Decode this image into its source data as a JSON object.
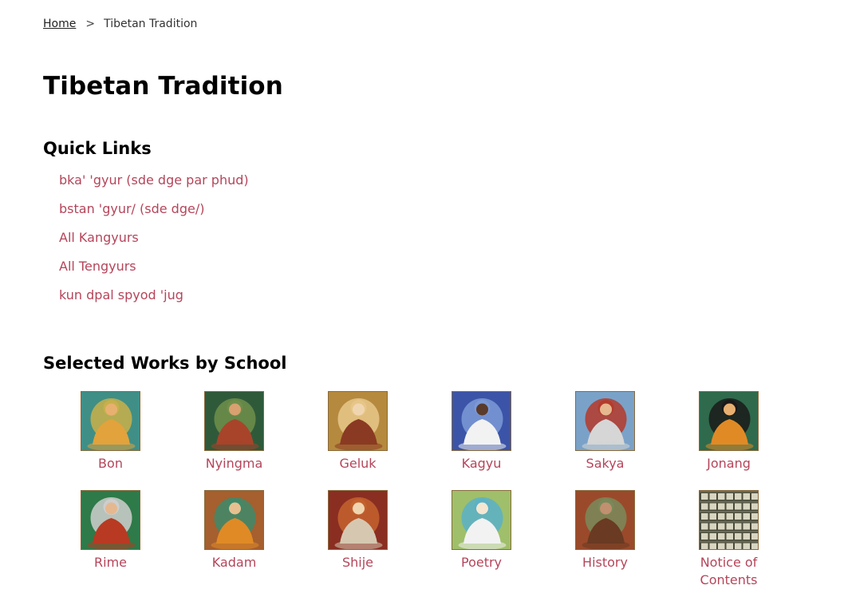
{
  "breadcrumb": {
    "home": "Home",
    "separator": ">",
    "current": "Tibetan Tradition"
  },
  "page_title": "Tibetan Tradition",
  "quick_links": {
    "heading": "Quick Links",
    "items": [
      "bka' 'gyur (sde dge par phud)",
      "bstan 'gyur/ (sde dge/)",
      "All Kangyurs",
      "All Tengyurs",
      "kun dpal spyod 'jug"
    ]
  },
  "selected_works": {
    "heading": "Selected Works by School",
    "schools": [
      {
        "label": "Bon",
        "icon": "thangka-bon-icon",
        "bg": "#3f8f86",
        "robe": "#e2a23c",
        "halo": "#c9b04a",
        "skin": "#e8b070"
      },
      {
        "label": "Nyingma",
        "icon": "thangka-nyingma-icon",
        "bg": "#2f5a3a",
        "robe": "#a8442a",
        "halo": "#6e8f4a",
        "skin": "#d9a070"
      },
      {
        "label": "Geluk",
        "icon": "thangka-geluk-icon",
        "bg": "#b58a3e",
        "robe": "#8a3a22",
        "halo": "#e7c789",
        "skin": "#f0d6b0"
      },
      {
        "label": "Kagyu",
        "icon": "thangka-kagyu-icon",
        "bg": "#3b54a8",
        "robe": "#f2f2f2",
        "halo": "#7c9ad6",
        "skin": "#5a3a2a"
      },
      {
        "label": "Sakya",
        "icon": "thangka-sakya-icon",
        "bg": "#7aa2c8",
        "robe": "#d6d6d6",
        "halo": "#b43a2a",
        "skin": "#e6b890"
      },
      {
        "label": "Jonang",
        "icon": "thangka-jonang-icon",
        "bg": "#2f6a4c",
        "robe": "#e08a26",
        "halo": "#1a1a1a",
        "skin": "#e8b070"
      },
      {
        "label": "Rime",
        "icon": "thangka-rime-icon",
        "bg": "#2e7a48",
        "robe": "#b83a22",
        "halo": "#cfcfcf",
        "skin": "#e6b890"
      },
      {
        "label": "Kadam",
        "icon": "thangka-kadam-icon",
        "bg": "#a65f2e",
        "robe": "#e08a26",
        "halo": "#3e8a6a",
        "skin": "#e8c090"
      },
      {
        "label": "Shije",
        "icon": "thangka-shije-icon",
        "bg": "#8a2e22",
        "robe": "#d6c8b0",
        "halo": "#c4622e",
        "skin": "#f0d6b0"
      },
      {
        "label": "Poetry",
        "icon": "thangka-poetry-icon",
        "bg": "#9fbf6a",
        "robe": "#f2f2f2",
        "halo": "#5ab0c8",
        "skin": "#f4e6d0"
      },
      {
        "label": "History",
        "icon": "thangka-history-icon",
        "bg": "#9a4a2a",
        "robe": "#6a3a22",
        "halo": "#7a8a5a",
        "skin": "#c09070"
      },
      {
        "label": "Notice of Contents",
        "icon": "library-shelves-icon",
        "bg": "#4a4a3a",
        "robe": "#e8e4d0",
        "halo": "#6a6a58",
        "skin": "#d8d4c0"
      }
    ]
  }
}
